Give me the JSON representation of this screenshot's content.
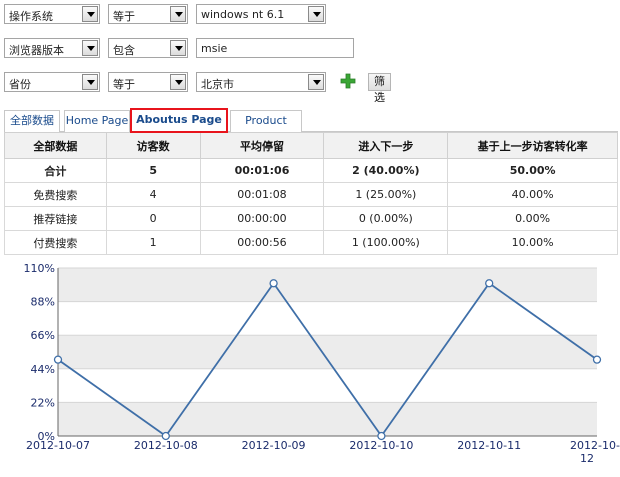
{
  "filters": [
    {
      "field": "操作系统",
      "operator": "等于",
      "value": "windows nt 6.1",
      "value_type": "select"
    },
    {
      "field": "浏览器版本",
      "operator": "包含",
      "value": "msie",
      "value_type": "text"
    },
    {
      "field": "省份",
      "operator": "等于",
      "value": "北京市",
      "value_type": "select"
    }
  ],
  "filter_button": "筛选",
  "tabs": [
    {
      "label": "全部数据",
      "active": false
    },
    {
      "label": "Home Page",
      "active": false
    },
    {
      "label": "Aboutus Page",
      "active": true
    },
    {
      "label": "Product Page",
      "active": false
    }
  ],
  "table": {
    "headers": [
      "全部数据",
      "访客数",
      "平均停留",
      "进入下一步",
      "基于上一步访客转化率"
    ],
    "rows": [
      [
        "合计",
        "5",
        "00:01:06",
        "2 (40.00%)",
        "50.00%"
      ],
      [
        "免费搜索",
        "4",
        "00:01:08",
        "1 (25.00%)",
        "40.00%"
      ],
      [
        "推荐链接",
        "0",
        "00:00:00",
        "0 (0.00%)",
        "0.00%"
      ],
      [
        "付费搜索",
        "1",
        "00:00:56",
        "1 (100.00%)",
        "10.00%"
      ]
    ]
  },
  "colors": {
    "accent": "#e8141c",
    "line": "#3f6fa8",
    "link": "#1a4b8c",
    "add": "#3aa635"
  },
  "chart_data": {
    "type": "line",
    "x": [
      "2012-10-07",
      "2012-10-08",
      "2012-10-09",
      "2012-10-10",
      "2012-10-11",
      "2012-10-12"
    ],
    "series": [
      {
        "values": [
          50,
          0,
          100,
          0,
          100,
          50
        ]
      }
    ],
    "y_ticks": [
      "110%",
      "88%",
      "66%",
      "44%",
      "22%",
      "0%"
    ],
    "ylim": [
      0,
      110
    ],
    "grid": true,
    "title": "",
    "xlabel": "",
    "ylabel": ""
  }
}
